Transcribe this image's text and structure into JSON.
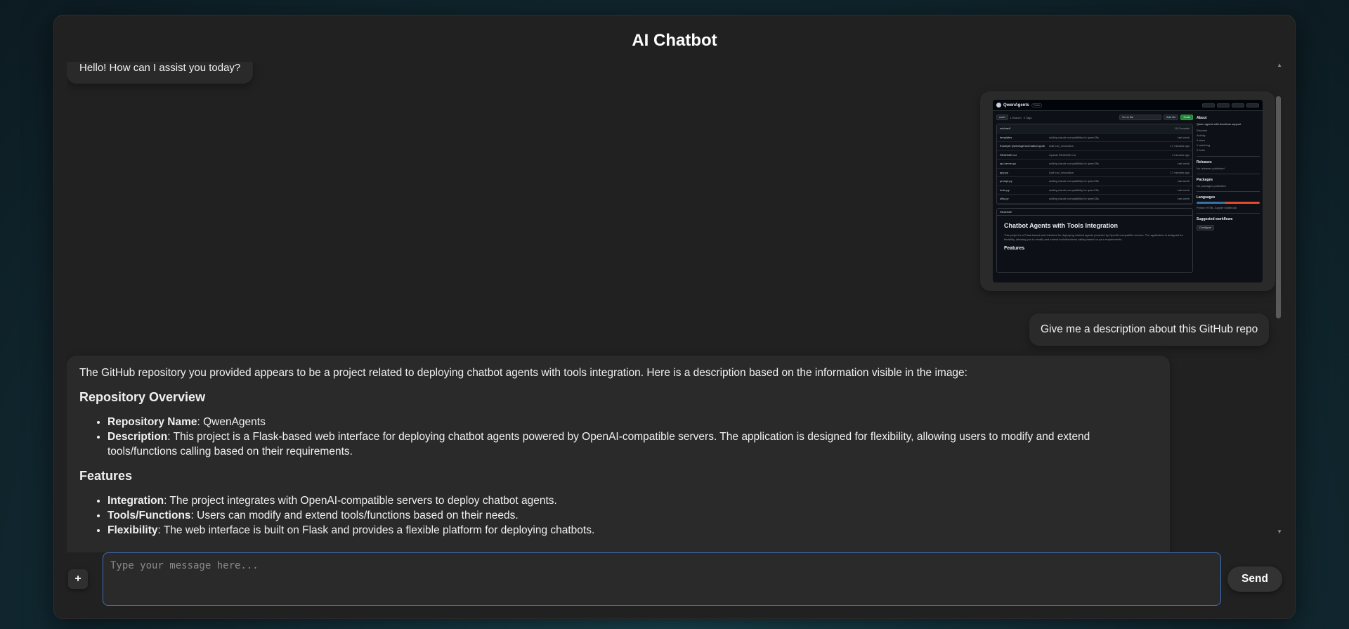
{
  "header": {
    "title": "AI Chatbot"
  },
  "messages": {
    "greeting": "Hello! How can I assist you today?",
    "user_prompt": "Give me a description about this GitHub repo",
    "response": {
      "intro": "The GitHub repository you provided appears to be a project related to deploying chatbot agents with tools integration. Here is a description based on the information visible in the image:",
      "overview_heading": "Repository Overview",
      "overview_items": [
        {
          "term": "Repository Name",
          "text": ": QwenAgents"
        },
        {
          "term": "Description",
          "text": ": This project is a Flask-based web interface for deploying chatbot agents powered by OpenAI-compatible servers. The application is designed for flexibility, allowing users to modify and extend tools/functions calling based on their requirements."
        }
      ],
      "features_heading": "Features",
      "features_items": [
        {
          "term": "Integration",
          "text": ": The project integrates with OpenAI-compatible servers to deploy chatbot agents."
        },
        {
          "term": "Tools/Functions",
          "text": ": Users can modify and extend tools/functions based on their needs."
        },
        {
          "term": "Flexibility",
          "text": ": The web interface is built on Flask and provides a flexible platform for deploying chatbots."
        }
      ]
    }
  },
  "screenshot": {
    "repo_name": "QwenAgents",
    "visibility": "Public",
    "branch": "main",
    "branches": "1 Branch",
    "tags": "0 Tags",
    "goto_file": "Go to file",
    "add_file": "Add file",
    "code": "Code",
    "commit_author": "michaelf",
    "commits": "10 Commits",
    "files": [
      {
        "name": "templates",
        "msg": "adding claude compatibility for qwen25s",
        "age": "last week"
      },
      {
        "name": "Example QwenAgentsChatbot.ipynb",
        "msg": "Add tool_invocation",
        "age": "17 minutes ago"
      },
      {
        "name": "README.md",
        "msg": "Update README.md",
        "age": "4 minutes ago"
      },
      {
        "name": "api-server.py",
        "msg": "adding claude compatibility for qwen25s",
        "age": "last week"
      },
      {
        "name": "app.py",
        "msg": "Add tool_invocation",
        "age": "17 minutes ago"
      },
      {
        "name": "prompt.py",
        "msg": "adding claude compatibility for qwen25s",
        "age": "last week"
      },
      {
        "name": "tools.py",
        "msg": "adding claude compatibility for qwen25s",
        "age": "last week"
      },
      {
        "name": "utils.py",
        "msg": "adding claude compatibility for qwen25s",
        "age": "last week"
      }
    ],
    "readme_tab": "README",
    "readme_title": "Chatbot Agents with Tools Integration",
    "readme_text": "This project is a Flask-based web interface for deploying chatbot agents powered by OpenAI-compatible servers. The application is designed for flexibility, allowing you to modify and extend tools/functions calling based on your requirements.",
    "readme_features": "Features",
    "about_heading": "About",
    "about_text": "Qwen agents with functions support",
    "about_links": [
      "Readme",
      "Activity",
      "0 stars",
      "1 watching",
      "0 forks"
    ],
    "releases_heading": "Releases",
    "releases_text": "No releases published",
    "packages_heading": "Packages",
    "packages_text": "No packages published",
    "languages_heading": "Languages",
    "languages": [
      "Python",
      "HTML",
      "Jupyter Notebook"
    ],
    "workflows_heading": "Suggested workflows",
    "configure": "Configure"
  },
  "composer": {
    "placeholder": "Type your message here...",
    "add_label": "+",
    "send_label": "Send"
  },
  "colors": {
    "accent": "#3b6fb6",
    "panel": "#212121",
    "bubble": "#2a2a2a"
  }
}
